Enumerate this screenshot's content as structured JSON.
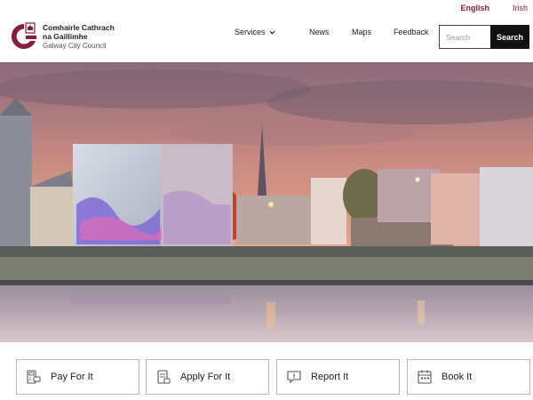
{
  "languages": [
    {
      "label": "English",
      "active": true
    },
    {
      "label": "Irish",
      "active": false
    }
  ],
  "logo": {
    "line1": "Comhairle Cathrach",
    "line2": "na Gaillimhe",
    "line3": "Galway City Council"
  },
  "nav": {
    "services": "Services",
    "news": "News",
    "maps": "Maps",
    "feedback": "Feedback"
  },
  "search": {
    "placeholder": "Search",
    "button": "Search"
  },
  "quick_links": [
    {
      "label": "Pay For It",
      "icon": "payment-terminal-icon"
    },
    {
      "label": "Apply For It",
      "icon": "document-application-icon"
    },
    {
      "label": "Report It",
      "icon": "report-message-icon"
    },
    {
      "label": "Book It",
      "icon": "calendar-icon"
    }
  ],
  "colors": {
    "brand": "#8c1c3a",
    "search_button": "#111111"
  }
}
